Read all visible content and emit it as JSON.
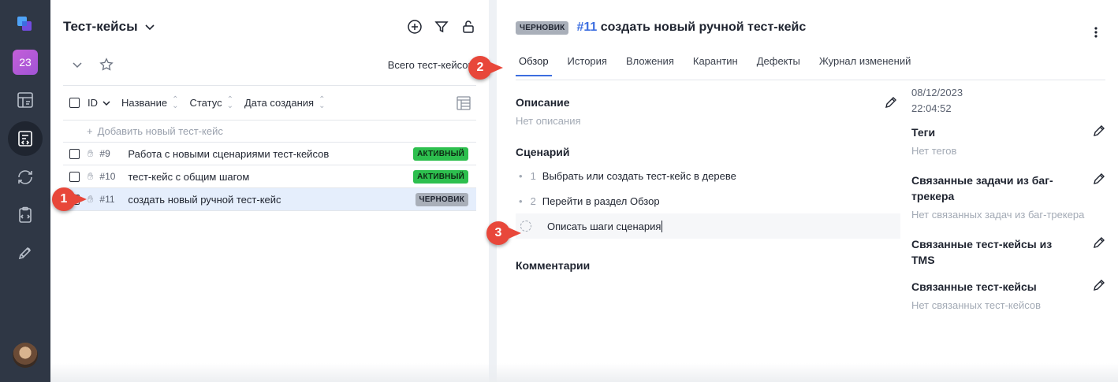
{
  "rail": {
    "badge_number": "23",
    "items": [
      {
        "icon": "app-logo-icon"
      },
      {
        "icon": "project-badge"
      },
      {
        "icon": "dashboard-icon"
      },
      {
        "icon": "test-cases-icon",
        "active": true
      },
      {
        "icon": "sync-icon"
      },
      {
        "icon": "clipboard-check-icon"
      },
      {
        "icon": "rocket-icon"
      }
    ]
  },
  "list": {
    "title": "Тест-кейсы",
    "total_label": "Всего тест-кейсов:",
    "columns": {
      "id": "ID",
      "name": "Название",
      "status": "Статус",
      "created": "Дата создания"
    },
    "add_label": "Добавить новый тест-кейс",
    "rows": [
      {
        "id": "#9",
        "name": "Работа с новыми сценариями тест-кейсов",
        "status": "АКТИВНЫЙ",
        "status_kind": "active"
      },
      {
        "id": "#10",
        "name": "тест-кейс с общим шагом",
        "status": "АКТИВНЫЙ",
        "status_kind": "active"
      },
      {
        "id": "#11",
        "name": "создать новый ручной тест-кейс",
        "status": "ЧЕРНОВИК",
        "status_kind": "draft",
        "selected": true
      }
    ]
  },
  "detail": {
    "status_badge": "ЧЕРНОВИК",
    "number": "#11",
    "title": "создать новый ручной тест-кейс",
    "tabs": [
      "Обзор",
      "История",
      "Вложения",
      "Карантин",
      "Дефекты",
      "Журнал изменений"
    ],
    "active_tab": "Обзор",
    "description": {
      "title": "Описание",
      "empty": "Нет описания"
    },
    "scenario": {
      "title": "Сценарий",
      "steps": [
        {
          "num": "1",
          "text": "Выбрать или создать тест-кейс в дереве"
        },
        {
          "num": "2",
          "text": "Перейти в раздел Обзор"
        }
      ],
      "new_step_text": "Описать шаги сценария"
    },
    "comments_title": "Комментарии",
    "side": {
      "date": "08/12/2023",
      "time": "22:04:52",
      "tags": {
        "title": "Теги",
        "empty": "Нет тегов"
      },
      "linked_issues": {
        "title": "Связанные задачи из баг-трекера",
        "empty": "Нет связанных задач из баг-трекера"
      },
      "linked_tms": {
        "title": "Связанные тест-кейсы из TMS"
      },
      "linked_cases": {
        "title": "Связанные тест-кейсы",
        "empty": "Нет связанных тест-кейсов"
      }
    }
  },
  "callouts": [
    "1",
    "2",
    "3"
  ],
  "colors": {
    "rail_bg": "#2f3745",
    "accent": "#3c6ee0",
    "active_badge": "#2dbf4e",
    "draft_badge": "#a9afb9",
    "callout": "#e8473a",
    "selected_row": "#e5eefc"
  }
}
